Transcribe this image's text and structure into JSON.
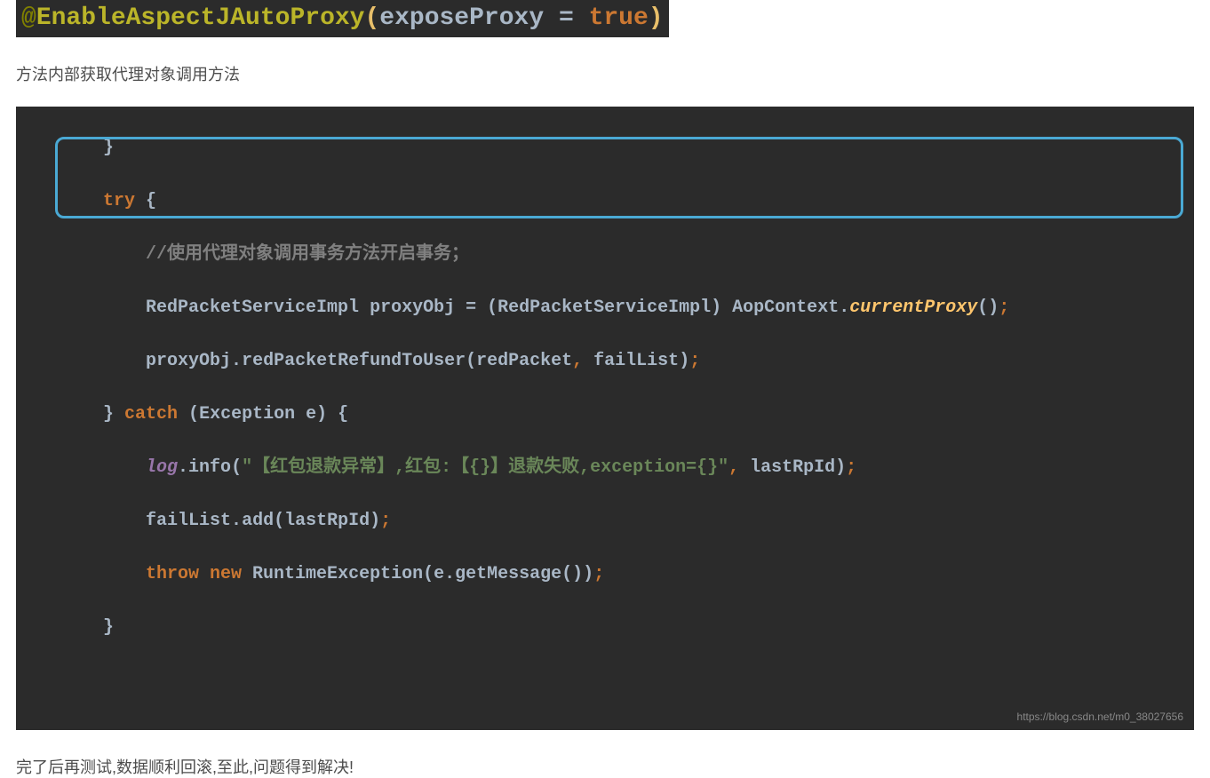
{
  "annotation": {
    "at": "@",
    "name": "EnableAspectJAutoProxy",
    "open_paren": "(",
    "param_key": "exposeProxy",
    "eq": " = ",
    "param_value": "true",
    "close_paren": ")"
  },
  "paragraph_before": "方法内部获取代理对象调用方法",
  "code": {
    "line1_brace": "       }",
    "line2_try": "       try ",
    "line2_brace": "{",
    "line3_comment": "           //使用代理对象调用事务方法开启事务；",
    "line4_type1": "           RedPacketServiceImpl ",
    "line4_var": "proxyObj",
    "line4_eq": " = ",
    "line4_paren_open": "(",
    "line4_cast": "RedPacketServiceImpl",
    "line4_paren_close": ") ",
    "line4_ctx": "AopContext",
    "line4_dot": ".",
    "line4_method": "currentProxy",
    "line4_call": "()",
    "line4_semi": ";",
    "line5_var": "           proxyObj",
    "line5_dot": ".",
    "line5_method": "redPacketRefundToUser",
    "line5_args_open": "(",
    "line5_arg1": "redPacket",
    "line5_comma": ", ",
    "line5_arg2": "failList",
    "line5_args_close": ")",
    "line5_semi": ";",
    "line6_brace_close": "       } ",
    "line6_catch": "catch ",
    "line6_paren_open": "(",
    "line6_exc_type": "Exception ",
    "line6_exc_var": "e",
    "line6_paren_close": ") ",
    "line6_brace_open": "{",
    "line7_log": "           log",
    "line7_dot": ".",
    "line7_info": "info",
    "line7_paren_open": "(",
    "line7_string": "\"【红包退款异常】,红包:【{}】退款失败,exception={}\"",
    "line7_comma": ", ",
    "line7_arg": "lastRpId",
    "line7_paren_close": ")",
    "line7_semi": ";",
    "line8_var": "           failList",
    "line8_dot": ".",
    "line8_method": "add",
    "line8_paren_open": "(",
    "line8_arg": "lastRpId",
    "line8_paren_close": ")",
    "line8_semi": ";",
    "line9_throw": "           throw new ",
    "line9_exc": "RuntimeException",
    "line9_paren_open": "(",
    "line9_e": "e",
    "line9_dot": ".",
    "line9_method": "getMessage",
    "line9_call": "()",
    "line9_paren_close": ")",
    "line9_semi": ";",
    "line10_brace": "       }",
    "watermark": "https://blog.csdn.net/m0_38027656"
  },
  "paragraph_after": "完了后再测试,数据顺利回滚,至此,问题得到解决!"
}
